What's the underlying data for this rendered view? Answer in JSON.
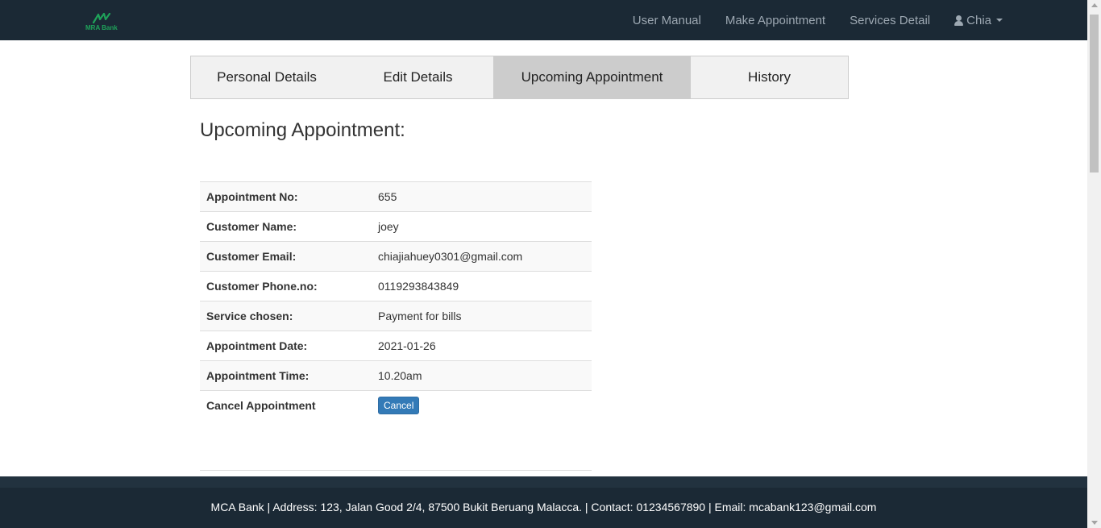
{
  "navbar": {
    "logo_text": "MRA Bank",
    "links": [
      "User Manual",
      "Make Appointment",
      "Services Detail"
    ],
    "user_name": "Chia"
  },
  "tabs": [
    "Personal Details",
    "Edit Details",
    "Upcoming Appointment",
    "History"
  ],
  "active_tab": "Upcoming Appointment",
  "heading": "Upcoming Appointment:",
  "appointment": {
    "rows": [
      {
        "label": "Appointment No:",
        "value": "655"
      },
      {
        "label": "Customer Name:",
        "value": "joey"
      },
      {
        "label": "Customer Email:",
        "value": "chiajiahuey0301@gmail.com"
      },
      {
        "label": "Customer Phone.no:",
        "value": "0119293843849"
      },
      {
        "label": "Service chosen:",
        "value": "Payment for bills"
      },
      {
        "label": "Appointment Date:",
        "value": "2021-01-26"
      },
      {
        "label": "Appointment Time:",
        "value": "10.20am"
      }
    ],
    "cancel_label": "Cancel Appointment",
    "cancel_button": "Cancel"
  },
  "footer": {
    "text": "MCA Bank | Address: 123, Jalan Good 2/4, 87500 Bukit Beruang Malacca. | Contact: 01234567890 | Email: mcabank123@gmail.com"
  },
  "colors": {
    "navbar_bg": "#1b2935",
    "active_tab_bg": "#cccccc",
    "button_primary": "#337ab7",
    "logo_green": "#1fa25a"
  }
}
